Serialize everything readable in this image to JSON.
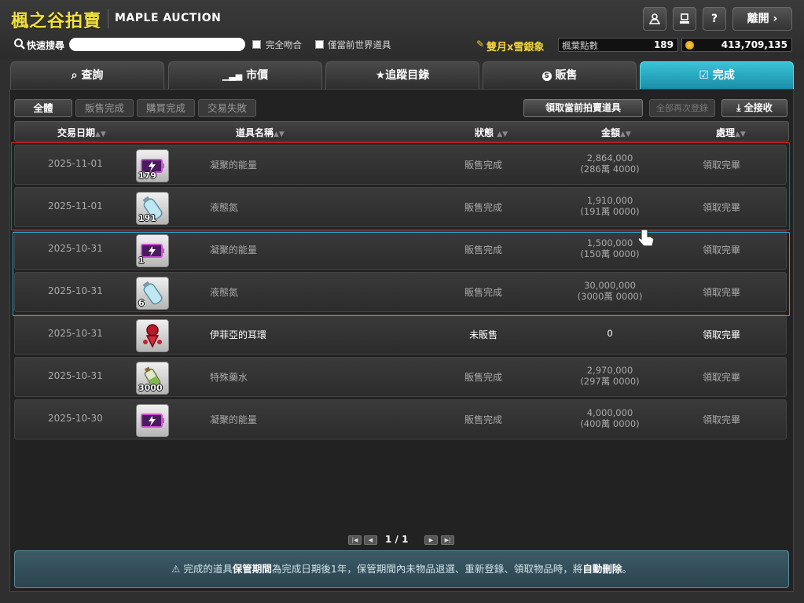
{
  "header": {
    "title": "楓之谷拍賣",
    "subtitle": "MAPLE AUCTION",
    "exit_label": "離開",
    "search_label": "快速搜尋",
    "search_value": "",
    "exact_match_label": "完全吻合",
    "current_world_label": "僅當前世界道具",
    "character_name": "雙月x雪銀象",
    "points_label": "楓葉點數",
    "points_value": "189",
    "mesos_value": "413,709,135"
  },
  "tabs": [
    {
      "label": "查詢",
      "icon": "search-icon"
    },
    {
      "label": "市價",
      "icon": "bar-chart-icon"
    },
    {
      "label": "追蹤目錄",
      "icon": "star-icon"
    },
    {
      "label": "販售",
      "icon": "coin-icon"
    },
    {
      "label": "完成",
      "icon": "checkbox-icon",
      "active": true
    }
  ],
  "filters": [
    "全體",
    "販售完成",
    "購買完成",
    "交易失敗"
  ],
  "actions": {
    "claim_current": "領取當前拍賣道具",
    "relist_all": "全部再次登錄",
    "claim_all": "全接收"
  },
  "columns": [
    "交易日期",
    "道具名稱",
    "狀態",
    "金額",
    "處理"
  ],
  "rows": [
    {
      "date": "2025-11-01",
      "qty": "179",
      "name": "凝聚的能量",
      "status": "販售完成",
      "amount": "2,864,000",
      "amount_sub": "(286萬 4000)",
      "action": "領取完畢",
      "item_icon": "purple-battery-icon"
    },
    {
      "date": "2025-11-01",
      "qty": "191",
      "name": "液態氮",
      "status": "販售完成",
      "amount": "1,910,000",
      "amount_sub": "(191萬 0000)",
      "action": "領取完畢",
      "item_icon": "nitrogen-tank-icon"
    },
    {
      "date": "2025-10-31",
      "qty": "1",
      "name": "凝聚的能量",
      "status": "販售完成",
      "amount": "1,500,000",
      "amount_sub": "(150萬 0000)",
      "action": "領取完畢",
      "item_icon": "purple-battery-icon"
    },
    {
      "date": "2025-10-31",
      "qty": "6",
      "name": "液態氮",
      "status": "販售完成",
      "amount": "30,000,000",
      "amount_sub": "(3000萬 0000)",
      "action": "領取完畢",
      "item_icon": "nitrogen-tank-icon"
    },
    {
      "date": "2025-10-31",
      "qty": "",
      "name": "伊菲亞的耳環",
      "status": "未販售",
      "amount": "0",
      "amount_sub": "",
      "action": "領取完畢",
      "item_icon": "red-earring-icon",
      "bright": true
    },
    {
      "date": "2025-10-31",
      "qty": "3000",
      "name": "特殊藥水",
      "status": "販售完成",
      "amount": "2,970,000",
      "amount_sub": "(297萬 0000)",
      "action": "領取完畢",
      "item_icon": "potion-icon"
    },
    {
      "date": "2025-10-30",
      "qty": "",
      "name": "凝聚的能量",
      "status": "販售完成",
      "amount": "4,000,000",
      "amount_sub": "(400萬 0000)",
      "action": "領取完畢",
      "item_icon": "purple-battery-icon"
    }
  ],
  "pager": {
    "text": "1 / 1"
  },
  "notice": {
    "part1": "完成的道具",
    "part2": "保管期間",
    "part3": "為完成日期後1年，保管期間內未物品退選、重新登錄、領取物品時，將",
    "part4": "自動刪除",
    "part5": "。"
  },
  "colors": {
    "accent_title": "#f2e13a",
    "active_tab": "#2aa9c0",
    "highlight_red": "#e02020",
    "highlight_blue": "#29a6d8"
  }
}
